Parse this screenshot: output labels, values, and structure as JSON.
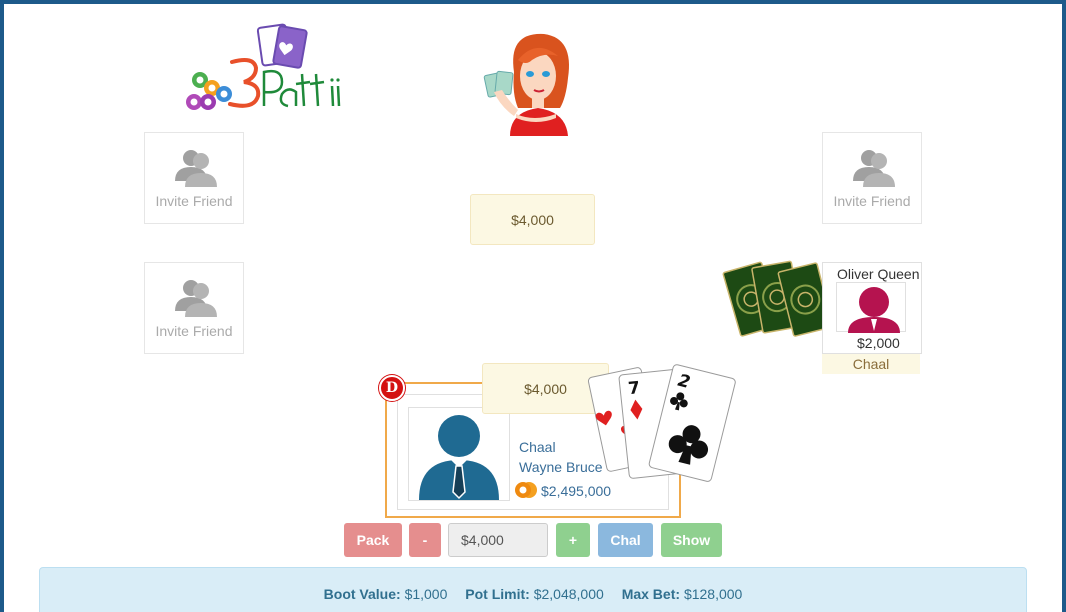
{
  "game": {
    "logo_text": "3Patti"
  },
  "seats": {
    "invite_label": "Invite Friend"
  },
  "pots": {
    "center_pot": "$4,000",
    "current_bet": "$4,000"
  },
  "opponent": {
    "name": "Oliver Queen",
    "money": "$2,000",
    "status": "Chaal",
    "avatar_color": "#b5134f"
  },
  "player": {
    "status": "Chaal",
    "name": "Wayne Bruce",
    "money": "$2,495,000",
    "dealer_badge": "D",
    "avatar_color": "#1f6a92",
    "cards": [
      {
        "rank": "",
        "suit": "hearts"
      },
      {
        "rank": "7",
        "suit": "diamonds"
      },
      {
        "rank": "2",
        "suit": "clubs"
      }
    ]
  },
  "controls": {
    "pack_label": "Pack",
    "minus_label": "-",
    "bet_value": "$4,000",
    "plus_label": "+",
    "chal_label": "Chal",
    "show_label": "Show"
  },
  "info": {
    "boot_label": "Boot Value:",
    "boot_value": "$1,000",
    "pot_limit_label": "Pot Limit:",
    "pot_limit_value": "$2,048,000",
    "max_bet_label": "Max Bet:",
    "max_bet_value": "$128,000"
  },
  "colors": {
    "frame": "#1d5a8a",
    "pack": "#e58e8e",
    "plus_show": "#8fd08f",
    "chal": "#8bb8de",
    "player_border": "#f0a94a"
  }
}
